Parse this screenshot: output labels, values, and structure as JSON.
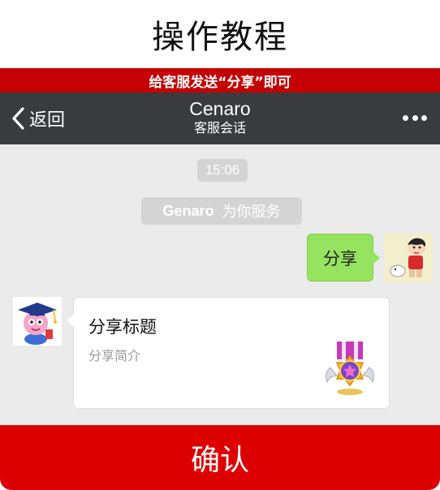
{
  "tutorial": {
    "title": "操作教程"
  },
  "banner": {
    "text": "给客服发送“分享”即可"
  },
  "navbar": {
    "back_label": "返回",
    "contact_name": "Cenaro",
    "subtitle": "客服会话"
  },
  "chat": {
    "timestamp": "15:06",
    "system_message": {
      "name": "Genaro",
      "text": "为你服务"
    },
    "sent_message": "分享",
    "share_card": {
      "title": "分享标题",
      "description": "分享简介"
    }
  },
  "confirm_button": {
    "label": "确认"
  },
  "colors": {
    "accent_red": "#dd0000",
    "banner_red": "#c40000",
    "navbar_bg": "#3a3b3f",
    "chat_bg": "#ebebeb",
    "bubble_green": "#96e35f"
  }
}
